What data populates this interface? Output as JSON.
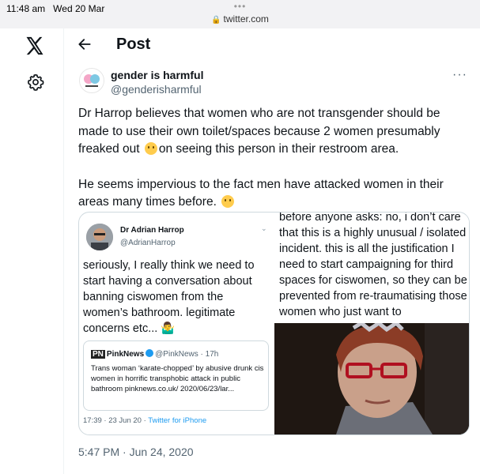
{
  "status_bar": {
    "time": "11:48 am",
    "date": "Wed 20 Mar",
    "dots": "•••",
    "url": "twitter.com"
  },
  "nav": {
    "logo": "x-logo-icon",
    "settings_icon": "gear-icon",
    "back_icon": "arrow-left-icon"
  },
  "header": {
    "title": "Post"
  },
  "tweet": {
    "author_name": "gender is harmful",
    "author_handle": "@genderisharmful",
    "more": "···",
    "paragraph1_a": "Dr Harrop believes that women who are not transgender should be made to use their own toilet/spaces because 2 women presumably freaked out",
    "paragraph1_b": "on seeing this person in their restroom area.",
    "paragraph2": "He seems impervious to the fact men have attacked women in their areas many times before.",
    "timestamp": "5:47 PM · Jun 24, 2020"
  },
  "quote": {
    "author_name": "Dr Adrian Harrop",
    "author_handle": "@AdrianHarrop",
    "text": "seriously, I really think we need to start having a conversation about banning ciswomen from the women’s bathroom. legitimate concerns etc... 🤷‍♂️",
    "right_text": "before anyone asks: no, i don’t care that this is a highly unusual / isolated incident. this is all the justification I need to start campaigning for third spaces for ciswomen, so they can be prevented from re-traumatising those women who just want to",
    "inner": {
      "logo": "PN",
      "name": "PinkNews",
      "handle_time": "@PinkNews · 17h",
      "text": "Trans woman ‘karate-chopped’ by abusive drunk cis women in horrific transphobic attack in public bathroom pinknews.co.uk/ 2020/06/23/lar..."
    },
    "footer_time": "17:39 · 23 Jun 20 · ",
    "footer_source": "Twitter for iPhone"
  }
}
